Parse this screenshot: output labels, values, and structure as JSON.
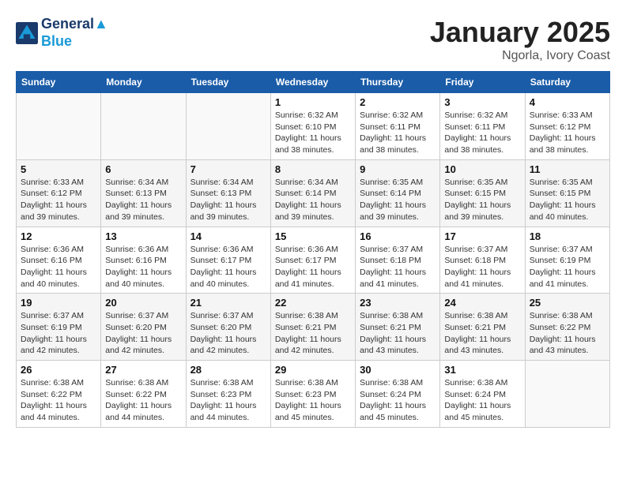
{
  "header": {
    "logo_line1": "General",
    "logo_line2": "Blue",
    "month": "January 2025",
    "location": "Ngorla, Ivory Coast"
  },
  "weekdays": [
    "Sunday",
    "Monday",
    "Tuesday",
    "Wednesday",
    "Thursday",
    "Friday",
    "Saturday"
  ],
  "weeks": [
    [
      {
        "day": "",
        "info": ""
      },
      {
        "day": "",
        "info": ""
      },
      {
        "day": "",
        "info": ""
      },
      {
        "day": "1",
        "info": "Sunrise: 6:32 AM\nSunset: 6:10 PM\nDaylight: 11 hours and 38 minutes."
      },
      {
        "day": "2",
        "info": "Sunrise: 6:32 AM\nSunset: 6:11 PM\nDaylight: 11 hours and 38 minutes."
      },
      {
        "day": "3",
        "info": "Sunrise: 6:32 AM\nSunset: 6:11 PM\nDaylight: 11 hours and 38 minutes."
      },
      {
        "day": "4",
        "info": "Sunrise: 6:33 AM\nSunset: 6:12 PM\nDaylight: 11 hours and 38 minutes."
      }
    ],
    [
      {
        "day": "5",
        "info": "Sunrise: 6:33 AM\nSunset: 6:12 PM\nDaylight: 11 hours and 39 minutes."
      },
      {
        "day": "6",
        "info": "Sunrise: 6:34 AM\nSunset: 6:13 PM\nDaylight: 11 hours and 39 minutes."
      },
      {
        "day": "7",
        "info": "Sunrise: 6:34 AM\nSunset: 6:13 PM\nDaylight: 11 hours and 39 minutes."
      },
      {
        "day": "8",
        "info": "Sunrise: 6:34 AM\nSunset: 6:14 PM\nDaylight: 11 hours and 39 minutes."
      },
      {
        "day": "9",
        "info": "Sunrise: 6:35 AM\nSunset: 6:14 PM\nDaylight: 11 hours and 39 minutes."
      },
      {
        "day": "10",
        "info": "Sunrise: 6:35 AM\nSunset: 6:15 PM\nDaylight: 11 hours and 39 minutes."
      },
      {
        "day": "11",
        "info": "Sunrise: 6:35 AM\nSunset: 6:15 PM\nDaylight: 11 hours and 40 minutes."
      }
    ],
    [
      {
        "day": "12",
        "info": "Sunrise: 6:36 AM\nSunset: 6:16 PM\nDaylight: 11 hours and 40 minutes."
      },
      {
        "day": "13",
        "info": "Sunrise: 6:36 AM\nSunset: 6:16 PM\nDaylight: 11 hours and 40 minutes."
      },
      {
        "day": "14",
        "info": "Sunrise: 6:36 AM\nSunset: 6:17 PM\nDaylight: 11 hours and 40 minutes."
      },
      {
        "day": "15",
        "info": "Sunrise: 6:36 AM\nSunset: 6:17 PM\nDaylight: 11 hours and 41 minutes."
      },
      {
        "day": "16",
        "info": "Sunrise: 6:37 AM\nSunset: 6:18 PM\nDaylight: 11 hours and 41 minutes."
      },
      {
        "day": "17",
        "info": "Sunrise: 6:37 AM\nSunset: 6:18 PM\nDaylight: 11 hours and 41 minutes."
      },
      {
        "day": "18",
        "info": "Sunrise: 6:37 AM\nSunset: 6:19 PM\nDaylight: 11 hours and 41 minutes."
      }
    ],
    [
      {
        "day": "19",
        "info": "Sunrise: 6:37 AM\nSunset: 6:19 PM\nDaylight: 11 hours and 42 minutes."
      },
      {
        "day": "20",
        "info": "Sunrise: 6:37 AM\nSunset: 6:20 PM\nDaylight: 11 hours and 42 minutes."
      },
      {
        "day": "21",
        "info": "Sunrise: 6:37 AM\nSunset: 6:20 PM\nDaylight: 11 hours and 42 minutes."
      },
      {
        "day": "22",
        "info": "Sunrise: 6:38 AM\nSunset: 6:21 PM\nDaylight: 11 hours and 42 minutes."
      },
      {
        "day": "23",
        "info": "Sunrise: 6:38 AM\nSunset: 6:21 PM\nDaylight: 11 hours and 43 minutes."
      },
      {
        "day": "24",
        "info": "Sunrise: 6:38 AM\nSunset: 6:21 PM\nDaylight: 11 hours and 43 minutes."
      },
      {
        "day": "25",
        "info": "Sunrise: 6:38 AM\nSunset: 6:22 PM\nDaylight: 11 hours and 43 minutes."
      }
    ],
    [
      {
        "day": "26",
        "info": "Sunrise: 6:38 AM\nSunset: 6:22 PM\nDaylight: 11 hours and 44 minutes."
      },
      {
        "day": "27",
        "info": "Sunrise: 6:38 AM\nSunset: 6:22 PM\nDaylight: 11 hours and 44 minutes."
      },
      {
        "day": "28",
        "info": "Sunrise: 6:38 AM\nSunset: 6:23 PM\nDaylight: 11 hours and 44 minutes."
      },
      {
        "day": "29",
        "info": "Sunrise: 6:38 AM\nSunset: 6:23 PM\nDaylight: 11 hours and 45 minutes."
      },
      {
        "day": "30",
        "info": "Sunrise: 6:38 AM\nSunset: 6:24 PM\nDaylight: 11 hours and 45 minutes."
      },
      {
        "day": "31",
        "info": "Sunrise: 6:38 AM\nSunset: 6:24 PM\nDaylight: 11 hours and 45 minutes."
      },
      {
        "day": "",
        "info": ""
      }
    ]
  ]
}
